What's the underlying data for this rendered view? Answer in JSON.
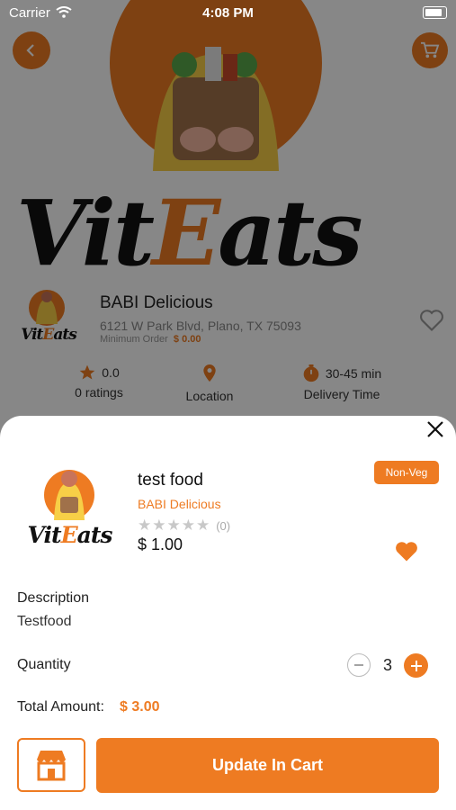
{
  "status_bar": {
    "carrier": "Carrier",
    "time": "4:08 PM"
  },
  "restaurant": {
    "brand_part1": "Vit",
    "brand_part2": "E",
    "brand_part3": "ats",
    "logo_text_part1": "Vit",
    "logo_text_part2": "E",
    "logo_text_part3": "ats",
    "name": "BABI Delicious",
    "address": "6121 W Park Blvd, Plano, TX 75093",
    "minimum_order_label": "Minimum Order",
    "minimum_order_value": "$ 0.00",
    "rating_value": "0.0",
    "rating_label": "0 ratings",
    "location_label": "Location",
    "delivery_time_value": "30-45 min",
    "delivery_time_label": "Delivery Time"
  },
  "item": {
    "name": "test food",
    "restaurant": "BABI Delicious",
    "stars": "★★★★★",
    "rating_count": "(0)",
    "price": "$ 1.00",
    "badge": "Non-Veg",
    "description_label": "Description",
    "description": "Testfood",
    "quantity_label": "Quantity",
    "quantity": "3",
    "total_label": "Total Amount:",
    "total_value": "$ 3.00",
    "update_button": "Update In Cart"
  },
  "colors": {
    "accent": "#ee7b22"
  },
  "icons": [
    "back-arrow-icon",
    "cart-icon",
    "star-icon",
    "location-pin-icon",
    "stopwatch-icon",
    "heart-outline-icon",
    "close-icon",
    "heart-filled-icon",
    "store-icon"
  ]
}
